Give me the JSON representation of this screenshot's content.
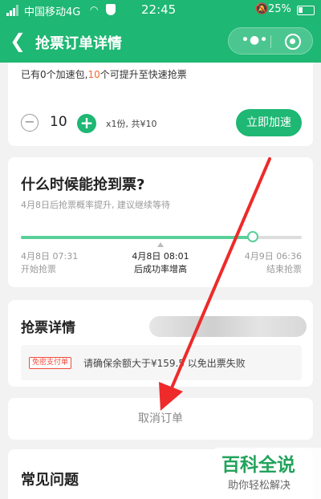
{
  "status_bar": {
    "carrier": "中国移动4G",
    "time": "22:45",
    "battery": "25%"
  },
  "nav": {
    "title": "抢票订单详情",
    "back_icon": "chevron-left-icon",
    "menu_icon": "more-dots-icon",
    "close_icon": "target-close-icon"
  },
  "speed_card": {
    "package_prefix": "已有0个加速包,",
    "package_count": "10",
    "package_suffix": "个可提升至快速抢票",
    "quantity": "10",
    "quantity_text": "x1份, 共¥10",
    "speedup_button": "立即加速"
  },
  "timing_card": {
    "title": "什么时候能抢到票?",
    "subtitle": "4月8日后抢票概率提升, 建议继续等待",
    "progress": 0.825,
    "left_time": "4月8日 07:31",
    "left_label": "开始抢票",
    "mid_time": "4月8日 08:01",
    "mid_label": "后成功率增高",
    "right_time": "4月9日 06:36",
    "right_label": "结束抢票"
  },
  "details_card": {
    "title": "抢票详情",
    "badge": "免密支付单",
    "notice": "请确保余额大于¥159.5 以免出票失败"
  },
  "cancel": {
    "label": "取消订单"
  },
  "faq": {
    "title": "常见问题"
  },
  "watermark": {
    "brand": "百科全说",
    "tagline": "助你轻松解决"
  },
  "colors": {
    "brand_green": "#1eb773",
    "accent_orange": "#f26a33",
    "arrow_red": "#ee2a2a"
  }
}
